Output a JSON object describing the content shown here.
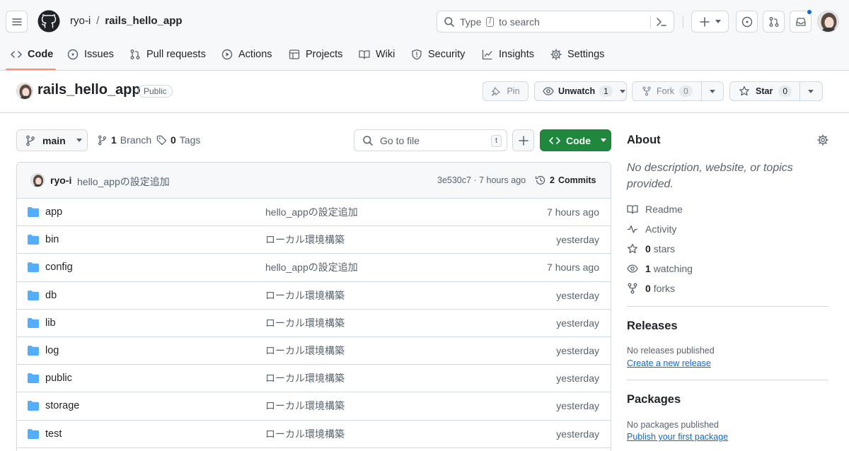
{
  "header": {
    "owner": "ryo-i",
    "separator": "/",
    "repo": "rails_hello_app",
    "search_type": "Type",
    "search_key": "/",
    "search_rest": "to search"
  },
  "nav": {
    "tabs": [
      {
        "label": "Code"
      },
      {
        "label": "Issues"
      },
      {
        "label": "Pull requests"
      },
      {
        "label": "Actions"
      },
      {
        "label": "Projects"
      },
      {
        "label": "Wiki"
      },
      {
        "label": "Security"
      },
      {
        "label": "Insights"
      },
      {
        "label": "Settings"
      }
    ]
  },
  "repo": {
    "name": "rails_hello_app",
    "visibility": "Public",
    "pin": "Pin",
    "unwatch": "Unwatch",
    "watch_count": "1",
    "fork": "Fork",
    "fork_count": "0",
    "star": "Star",
    "star_count": "0"
  },
  "branchbar": {
    "branch": "main",
    "branch_count": "1",
    "branch_label": "Branch",
    "tag_count": "0",
    "tag_label": "Tags",
    "goto_placeholder": "Go to file",
    "goto_key": "t",
    "code_button": "Code"
  },
  "commit": {
    "author": "ryo-i",
    "message": "hello_appの設定追加",
    "meta": "3e530c7 · 7 hours ago",
    "commits_count": "2",
    "commits_label": "Commits"
  },
  "files": [
    {
      "name": "app",
      "message": "hello_appの設定追加",
      "date": "7 hours ago"
    },
    {
      "name": "bin",
      "message": "ローカル環境構築",
      "date": "yesterday"
    },
    {
      "name": "config",
      "message": "hello_appの設定追加",
      "date": "7 hours ago"
    },
    {
      "name": "db",
      "message": "ローカル環境構築",
      "date": "yesterday"
    },
    {
      "name": "lib",
      "message": "ローカル環境構築",
      "date": "yesterday"
    },
    {
      "name": "log",
      "message": "ローカル環境構築",
      "date": "yesterday"
    },
    {
      "name": "public",
      "message": "ローカル環境構築",
      "date": "yesterday"
    },
    {
      "name": "storage",
      "message": "ローカル環境構築",
      "date": "yesterday"
    },
    {
      "name": "test",
      "message": "ローカル環境構築",
      "date": "yesterday"
    }
  ],
  "about": {
    "title": "About",
    "description": "No description, website, or topics provided.",
    "readme": "Readme",
    "activity": "Activity",
    "stars_count": "0",
    "stars_label": "stars",
    "watching_count": "1",
    "watching_label": "watching",
    "forks_count": "0",
    "forks_label": "forks"
  },
  "releases": {
    "title": "Releases",
    "empty": "No releases published",
    "link": "Create a new release"
  },
  "packages": {
    "title": "Packages",
    "empty": "No packages published",
    "link": "Publish your first package"
  },
  "colors": {
    "accent_green": "#1f883d",
    "folder_blue": "#54aeff",
    "link_blue": "#0969da",
    "tab_underline": "#fd8c73",
    "notification_dot": "#0969da"
  }
}
